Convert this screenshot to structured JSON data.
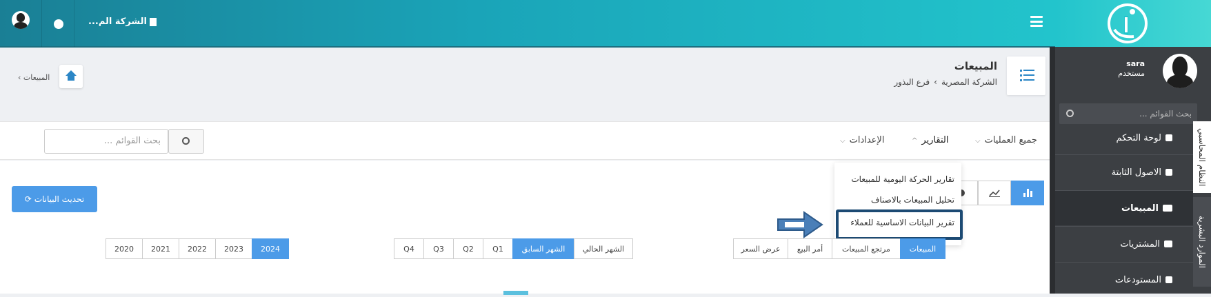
{
  "topbar": {
    "company": "الشركة الم..."
  },
  "sidebar": {
    "user_name": "sara",
    "user_role": "مستخدم",
    "search_placeholder": "بحث القوائم ...",
    "items": [
      {
        "label": "لوحة التحكم"
      },
      {
        "label": "الاصول الثابتة"
      },
      {
        "label": "المبيعات"
      },
      {
        "label": "المشتريات"
      },
      {
        "label": "المستودعات"
      }
    ],
    "vertical_tabs": [
      "النظام المحاسبي",
      "الموارد البشرية"
    ]
  },
  "header": {
    "title": "المبيعات",
    "breadcrumb": [
      "الشركة المصرية",
      "فرع البذور"
    ],
    "left_crumb": "المبيعات"
  },
  "nav": {
    "all_ops": "جميع العمليات",
    "reports": "التقارير",
    "settings": "الإعدادات",
    "search_placeholder": "بحث القوائم ..."
  },
  "dropdown": {
    "items": [
      "تقارير الحركة اليومية للمبيعات",
      "تحليل المبيعات بالاصناف",
      "تقرير البيانات الاساسية للعملاء"
    ]
  },
  "refresh_label": "تحديث البيانات",
  "filters": {
    "types": [
      {
        "label": "المبيعات",
        "active": true
      },
      {
        "label": "مرتجع المبيعات",
        "active": false
      },
      {
        "label": "أمر البيع",
        "active": false
      },
      {
        "label": "عرض السعر",
        "active": false
      }
    ],
    "periods": [
      {
        "label": "الشهر الحالي",
        "active": false
      },
      {
        "label": "الشهر السابق",
        "active": true
      },
      {
        "label": "Q1",
        "active": false
      },
      {
        "label": "Q2",
        "active": false
      },
      {
        "label": "Q3",
        "active": false
      },
      {
        "label": "Q4",
        "active": false
      }
    ],
    "years": [
      {
        "label": "2024",
        "active": true
      },
      {
        "label": "2023",
        "active": false
      },
      {
        "label": "2022",
        "active": false
      },
      {
        "label": "2021",
        "active": false
      },
      {
        "label": "2020",
        "active": false
      }
    ]
  },
  "colors": {
    "accent": "#4c9be8",
    "topbar": "#1aa4b8",
    "sidebar": "#3c3f43",
    "highlight_box": "#1c4a73"
  }
}
